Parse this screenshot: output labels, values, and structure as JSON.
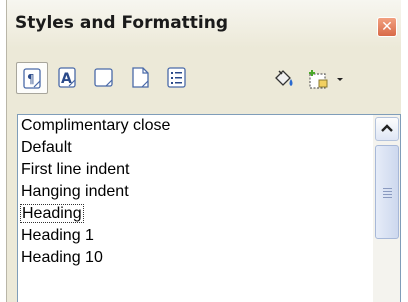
{
  "window": {
    "title": "Styles and Formatting",
    "close_glyph": "✕"
  },
  "toolbar": {
    "buttons": [
      {
        "icon": "paragraph-styles-icon",
        "active": true
      },
      {
        "icon": "character-styles-icon",
        "active": false
      },
      {
        "icon": "frame-styles-icon",
        "active": false
      },
      {
        "icon": "page-styles-icon",
        "active": false
      },
      {
        "icon": "list-styles-icon",
        "active": false
      },
      {
        "icon": "fill-format-mode-icon",
        "active": false
      },
      {
        "icon": "new-style-from-selection-icon",
        "active": false
      }
    ]
  },
  "style_list": {
    "items": [
      "Complimentary close",
      "Default",
      "First line indent",
      "Hanging indent",
      "Heading",
      "Heading 1",
      "Heading 10"
    ],
    "selected": "Heading"
  },
  "colors": {
    "panel_bg": "#ece9d8",
    "list_border": "#7f9db9",
    "close_button": "#d86a48"
  }
}
